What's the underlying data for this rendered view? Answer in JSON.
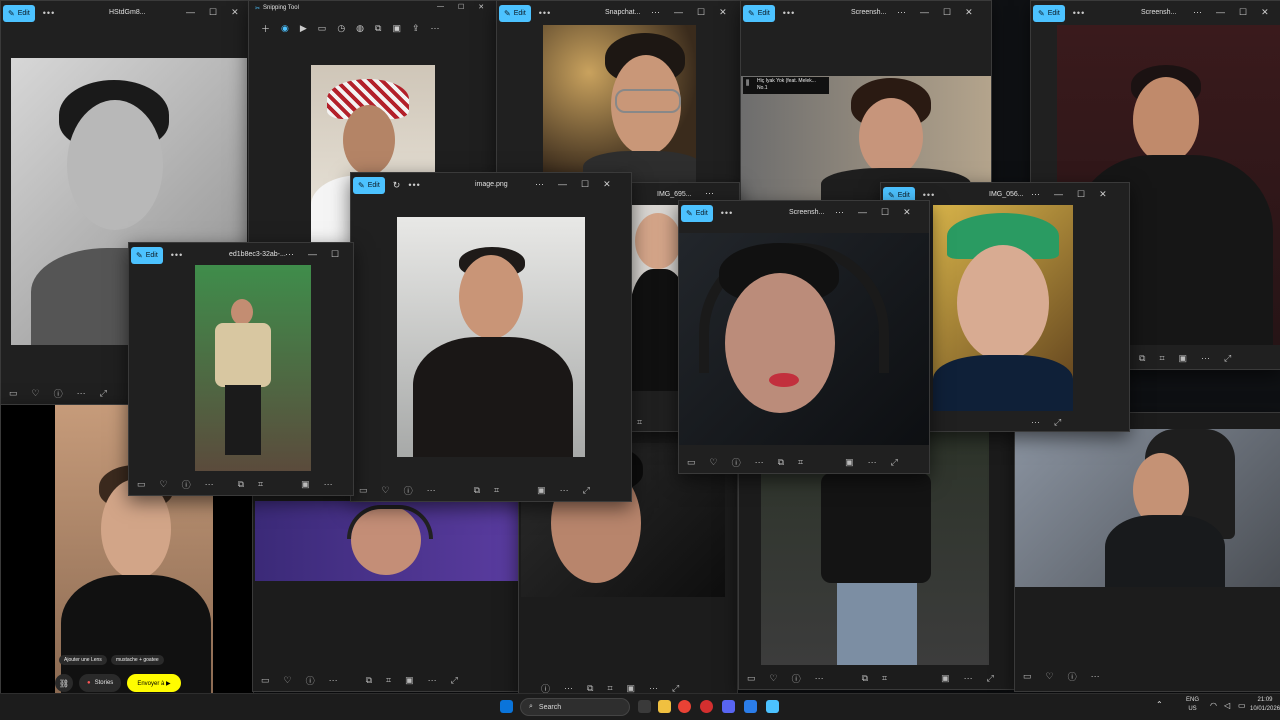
{
  "desktop": {
    "background": "#0f1114"
  },
  "common": {
    "edit_label": "Edit",
    "more": "•••",
    "minimize": "—",
    "maximize": "☐",
    "close": "✕"
  },
  "windows": {
    "w1": {
      "title": "HStdGm8..."
    },
    "w2": {
      "title": "Snipping Tool"
    },
    "w3": {
      "title": "Snapchat..."
    },
    "w4": {
      "title": "Screensh...",
      "notification": "Hiç Iyak Yok (feat. Melek... No.1"
    },
    "w5": {
      "title": "Screensh..."
    },
    "w6": {
      "title": "image.png"
    },
    "w7": {
      "title": "ed1b8ec3-32ab-..."
    },
    "w8": {
      "title": "IMG_695..."
    },
    "w9": {
      "title": "Screensh..."
    },
    "w10": {
      "title": "IMG_056..."
    }
  },
  "snapchat": {
    "chip1": "Ajouter une Lens",
    "chip2": "mustache + goatee",
    "stories": "Stories",
    "send": "Envoyer à ▶"
  },
  "taskbar": {
    "search_placeholder": "Search",
    "lang": "ENG",
    "region": "US",
    "time": "21:09",
    "date": "10/01/2026"
  },
  "colors": {
    "accent": "#4cc2ff",
    "snap_yellow": "#fffc00"
  }
}
